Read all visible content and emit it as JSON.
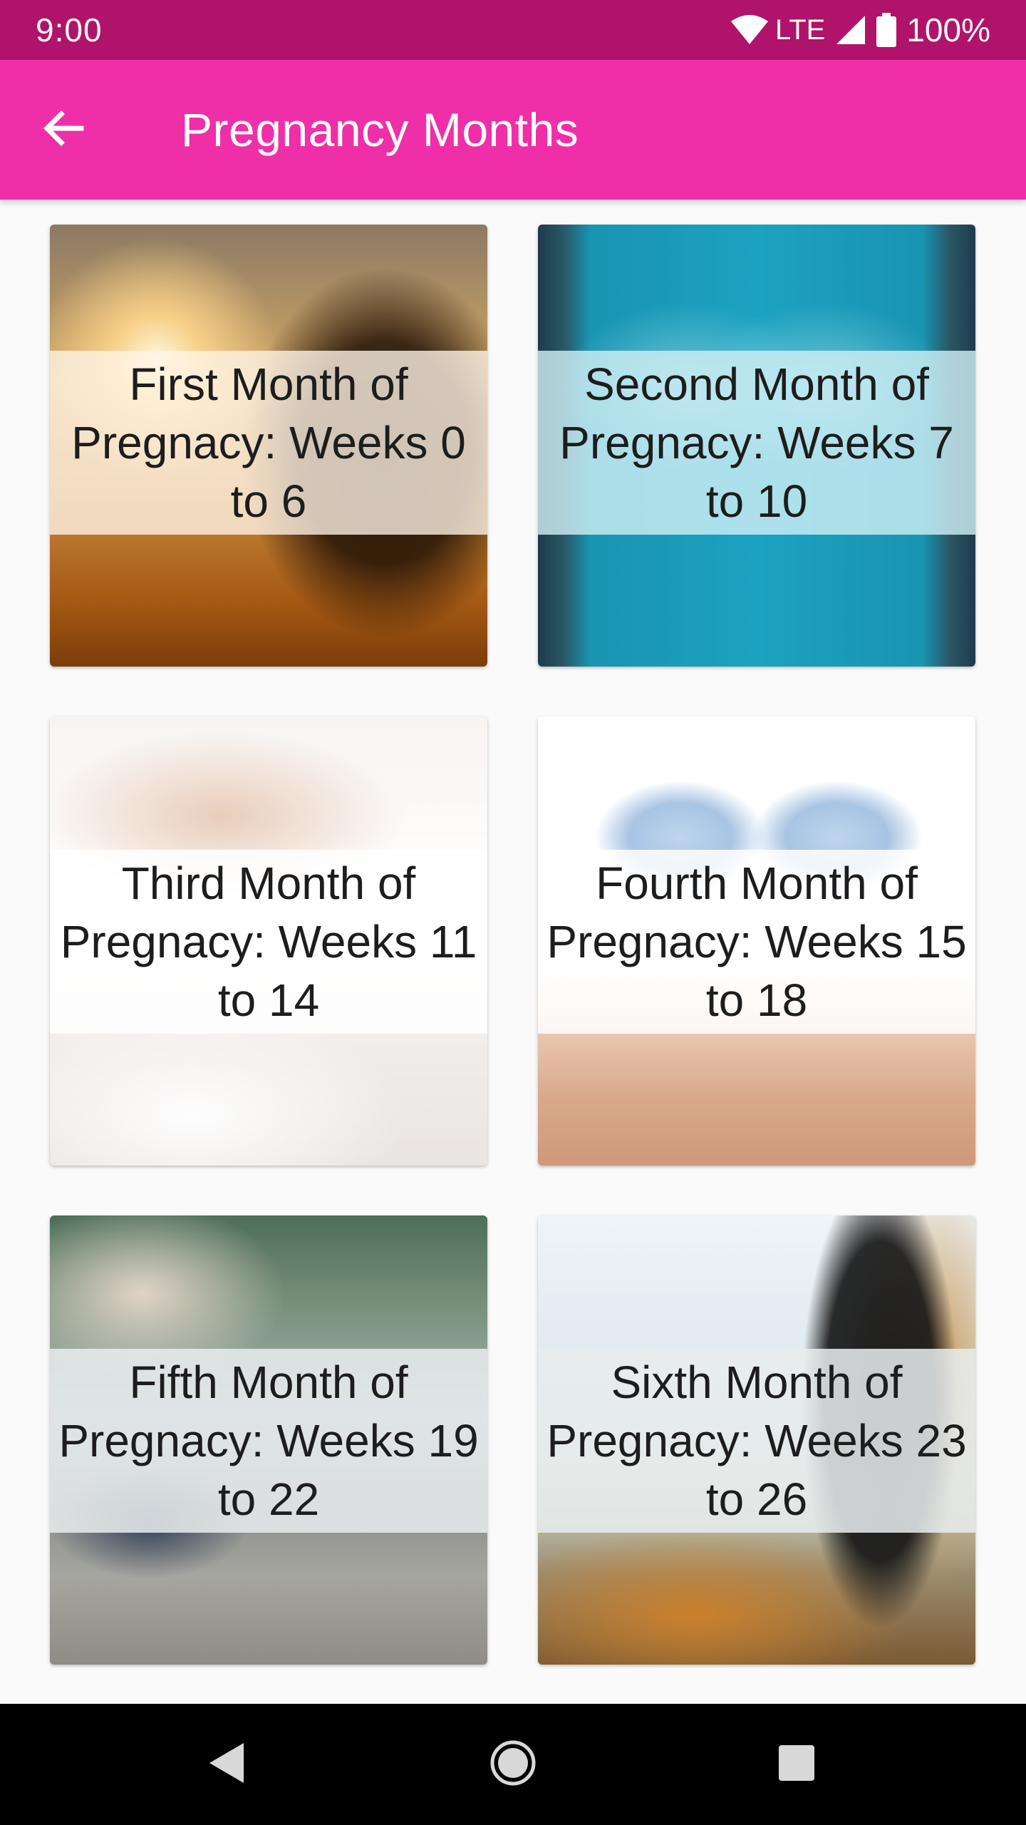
{
  "status_bar": {
    "time": "9:00",
    "network": "LTE",
    "battery": "100%",
    "icons": [
      "wifi-icon",
      "signal-icon",
      "battery-icon"
    ]
  },
  "app_bar": {
    "title": "Pregnancy Months",
    "back_icon": "arrow-back-icon",
    "color": "#ef2fa8",
    "status_color": "#b0136a"
  },
  "cards": [
    {
      "label": "First Month of Pregnacy: Weeks 0 to 6"
    },
    {
      "label": "Second Month of Pregnacy: Weeks 7 to 10"
    },
    {
      "label": "Third Month of Pregnacy: Weeks 11 to 14"
    },
    {
      "label": "Fourth Month of Pregnacy: Weeks 15 to 18"
    },
    {
      "label": "Fifth Month of Pregnacy: Weeks 19 to 22"
    },
    {
      "label": "Sixth Month of Pregnacy: Weeks 23 to 26"
    }
  ],
  "nav_bar": {
    "icons": [
      "back-triangle-icon",
      "home-circle-icon",
      "recents-square-icon"
    ]
  }
}
